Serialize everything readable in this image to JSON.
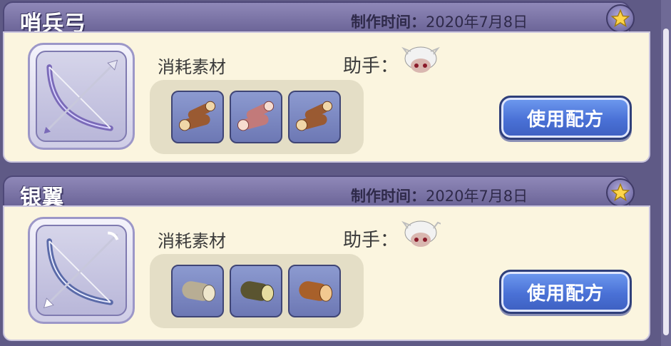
{
  "cards": [
    {
      "title": "哨兵弓",
      "made_label": "制作时间：",
      "made_date": "2020年7月8日",
      "materials_label": "消耗素材",
      "helper_label": "助手：",
      "button_label": "使用配方",
      "bow_color": "#7a6ab8",
      "materials": [
        {
          "icon": "wood-log-icon",
          "color": "#9a5a32"
        },
        {
          "icon": "wood-log-icon",
          "color": "#c27a7a"
        },
        {
          "icon": "wood-log-icon",
          "color": "#9a5a32"
        }
      ]
    },
    {
      "title": "银翼",
      "made_label": "制作时间：",
      "made_date": "2020年7月8日",
      "materials_label": "消耗素材",
      "helper_label": "助手：",
      "button_label": "使用配方",
      "bow_color": "#5a6aa8",
      "materials": [
        {
          "icon": "wood-log-icon",
          "color": "#b8ad94"
        },
        {
          "icon": "wood-log-icon",
          "color": "#5a5430"
        },
        {
          "icon": "wood-log-icon",
          "color": "#a8602a"
        }
      ]
    }
  ]
}
